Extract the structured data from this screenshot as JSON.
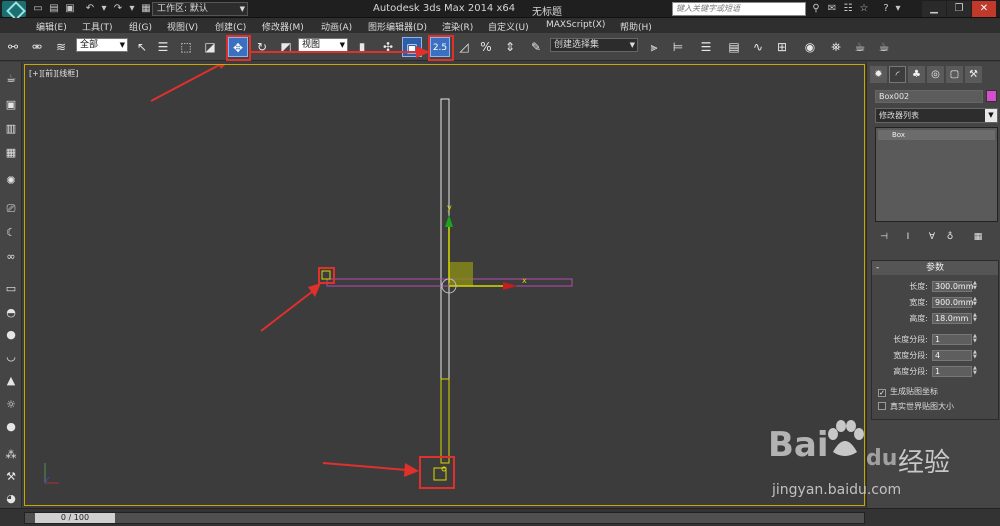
{
  "titlebar": {
    "workspace_label": "工作区: 默认",
    "app_title": "Autodesk 3ds Max  2014 x64",
    "doc_title": "无标题",
    "search_placeholder": "键入关键字或短语"
  },
  "menu": [
    "编辑(E)",
    "工具(T)",
    "组(G)",
    "视图(V)",
    "创建(C)",
    "修改器(M)",
    "动画(A)",
    "图形编辑器(D)",
    "渲染(R)",
    "自定义(U)",
    "MAXScript(X)",
    "帮助(H)"
  ],
  "toolbar": {
    "selection_filter": "全部",
    "ref_coord": "视图",
    "snap_value": "2.5",
    "named_selection": "创建选择集"
  },
  "viewport": {
    "label": "[+][前][线框]",
    "axis_x": "x",
    "axis_y": "y"
  },
  "panel": {
    "object_name": "Box002",
    "object_color": "#d34fd0",
    "modifier_list": "修改器列表",
    "stack_item": "Box",
    "rollout_title": "参数",
    "params": {
      "length_label": "长度:",
      "length_value": "300.0mm",
      "width_label": "宽度:",
      "width_value": "900.0mm",
      "height_label": "高度:",
      "height_value": "18.0mm",
      "length_segs_label": "长度分段:",
      "length_segs_value": "1",
      "width_segs_label": "宽度分段:",
      "width_segs_value": "4",
      "height_segs_label": "高度分段:",
      "height_segs_value": "1"
    },
    "gen_map_coords": "生成贴图坐标",
    "real_world_map": "真实世界贴图大小"
  },
  "timeline": {
    "frame": "0 / 100"
  },
  "watermark": {
    "brand": "Bai",
    "brand2": "du",
    "suffix": "经验",
    "url": "jingyan.baidu.com"
  }
}
